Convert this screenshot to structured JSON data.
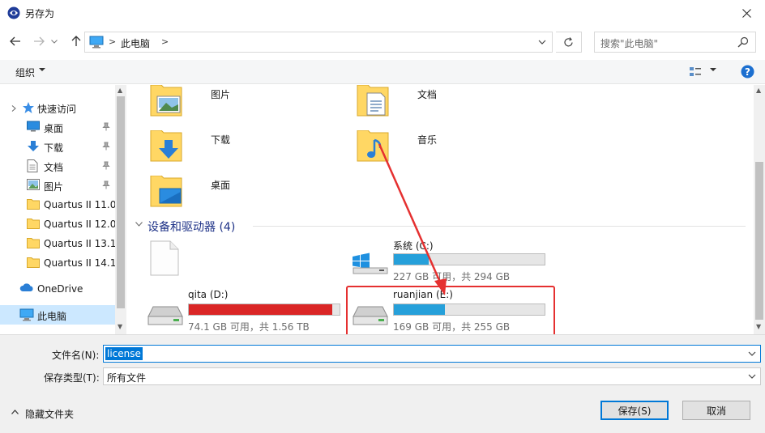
{
  "window": {
    "title": "另存为"
  },
  "nav": {
    "breadcrumb": [
      "此电脑"
    ],
    "search_placeholder": "搜索\"此电脑\""
  },
  "toolbar": {
    "organize_label": "组织"
  },
  "sidebar": {
    "items": [
      {
        "label": "快速访问",
        "icon": "star-icon"
      },
      {
        "label": "桌面",
        "icon": "desktop-icon",
        "pinned": true
      },
      {
        "label": "下载",
        "icon": "download-icon",
        "pinned": true
      },
      {
        "label": "文档",
        "icon": "document-icon",
        "pinned": true
      },
      {
        "label": "图片",
        "icon": "picture-icon",
        "pinned": true
      },
      {
        "label": "Quartus II 11.0",
        "icon": "folder-icon"
      },
      {
        "label": "Quartus II 12.0",
        "icon": "folder-icon"
      },
      {
        "label": "Quartus II 13.1",
        "icon": "folder-icon"
      },
      {
        "label": "Quartus II 14.1",
        "icon": "folder-icon"
      },
      {
        "label": "OneDrive",
        "icon": "cloud-icon"
      },
      {
        "label": "此电脑",
        "icon": "computer-icon",
        "selected": true
      }
    ]
  },
  "main": {
    "folders": [
      {
        "label": "图片",
        "icon": "pictures-folder-icon"
      },
      {
        "label": "文档",
        "icon": "documents-folder-icon"
      },
      {
        "label": "下载",
        "icon": "downloads-folder-icon"
      },
      {
        "label": "音乐",
        "icon": "music-folder-icon"
      },
      {
        "label": "桌面",
        "icon": "desktop-folder-icon"
      }
    ],
    "devices_header": "设备和驱动器 (4)",
    "drives": [
      {
        "name": "",
        "space": "",
        "icon": "blank-file-icon"
      },
      {
        "name": "系统 (C:)",
        "space": "227 GB 可用，共 294 GB",
        "used_fraction": 0.23,
        "bar_color": "#26a0da",
        "icon": "windows-drive-icon"
      },
      {
        "name": "qita (D:)",
        "space": "74.1 GB 可用，共 1.56 TB",
        "used_fraction": 0.95,
        "bar_color": "#da2626",
        "icon": "hard-drive-icon"
      },
      {
        "name": "ruanjian (E:)",
        "space": "169 GB 可用，共 255 GB",
        "used_fraction": 0.34,
        "bar_color": "#26a0da",
        "icon": "hard-drive-icon"
      }
    ]
  },
  "bottom": {
    "filename_label": "文件名(N):",
    "filename_value": "license",
    "filetype_label": "保存类型(T):",
    "filetype_value": "所有文件",
    "hide_folders_label": "隐藏文件夹",
    "save_label": "保存(S)",
    "cancel_label": "取消"
  },
  "colors": {
    "accent": "#0078d7",
    "annotation": "#e53030"
  }
}
